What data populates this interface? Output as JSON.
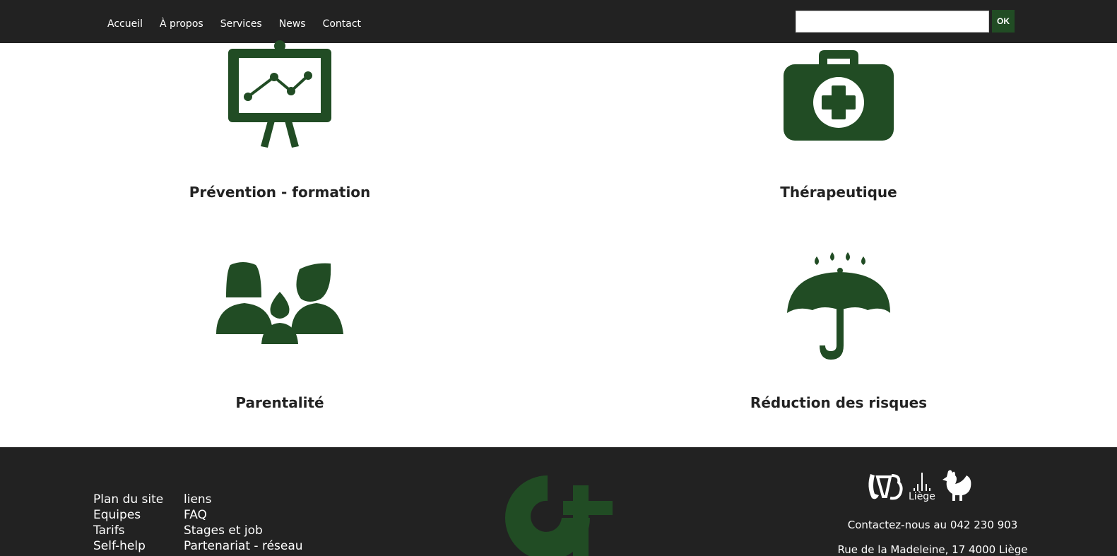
{
  "nav": {
    "items": [
      "Accueil",
      "À propos",
      "Services",
      "News",
      "Contact"
    ],
    "search_placeholder": "",
    "ok_label": "OK"
  },
  "services": [
    {
      "label": "Prévention - formation",
      "icon": "presentation-board-icon"
    },
    {
      "label": "Thérapeutique",
      "icon": "first-aid-kit-icon"
    },
    {
      "label": "Parentalité",
      "icon": "family-icon"
    },
    {
      "label": "Réduction des risques",
      "icon": "umbrella-rain-icon"
    }
  ],
  "footer": {
    "links_col1": [
      "Plan du site",
      "Equipes",
      "Tarifs",
      "Self-help"
    ],
    "links_col2": [
      "liens",
      "FAQ",
      "Stages et job",
      "Partenariat - réseau"
    ],
    "logo_text": "Liège",
    "contact_line": "Contactez-nous au 042 230 903",
    "address_line": "Rue de la Madeleine, 17 4000 Liège"
  },
  "colors": {
    "accent": "#214c24",
    "bar": "#222222"
  }
}
